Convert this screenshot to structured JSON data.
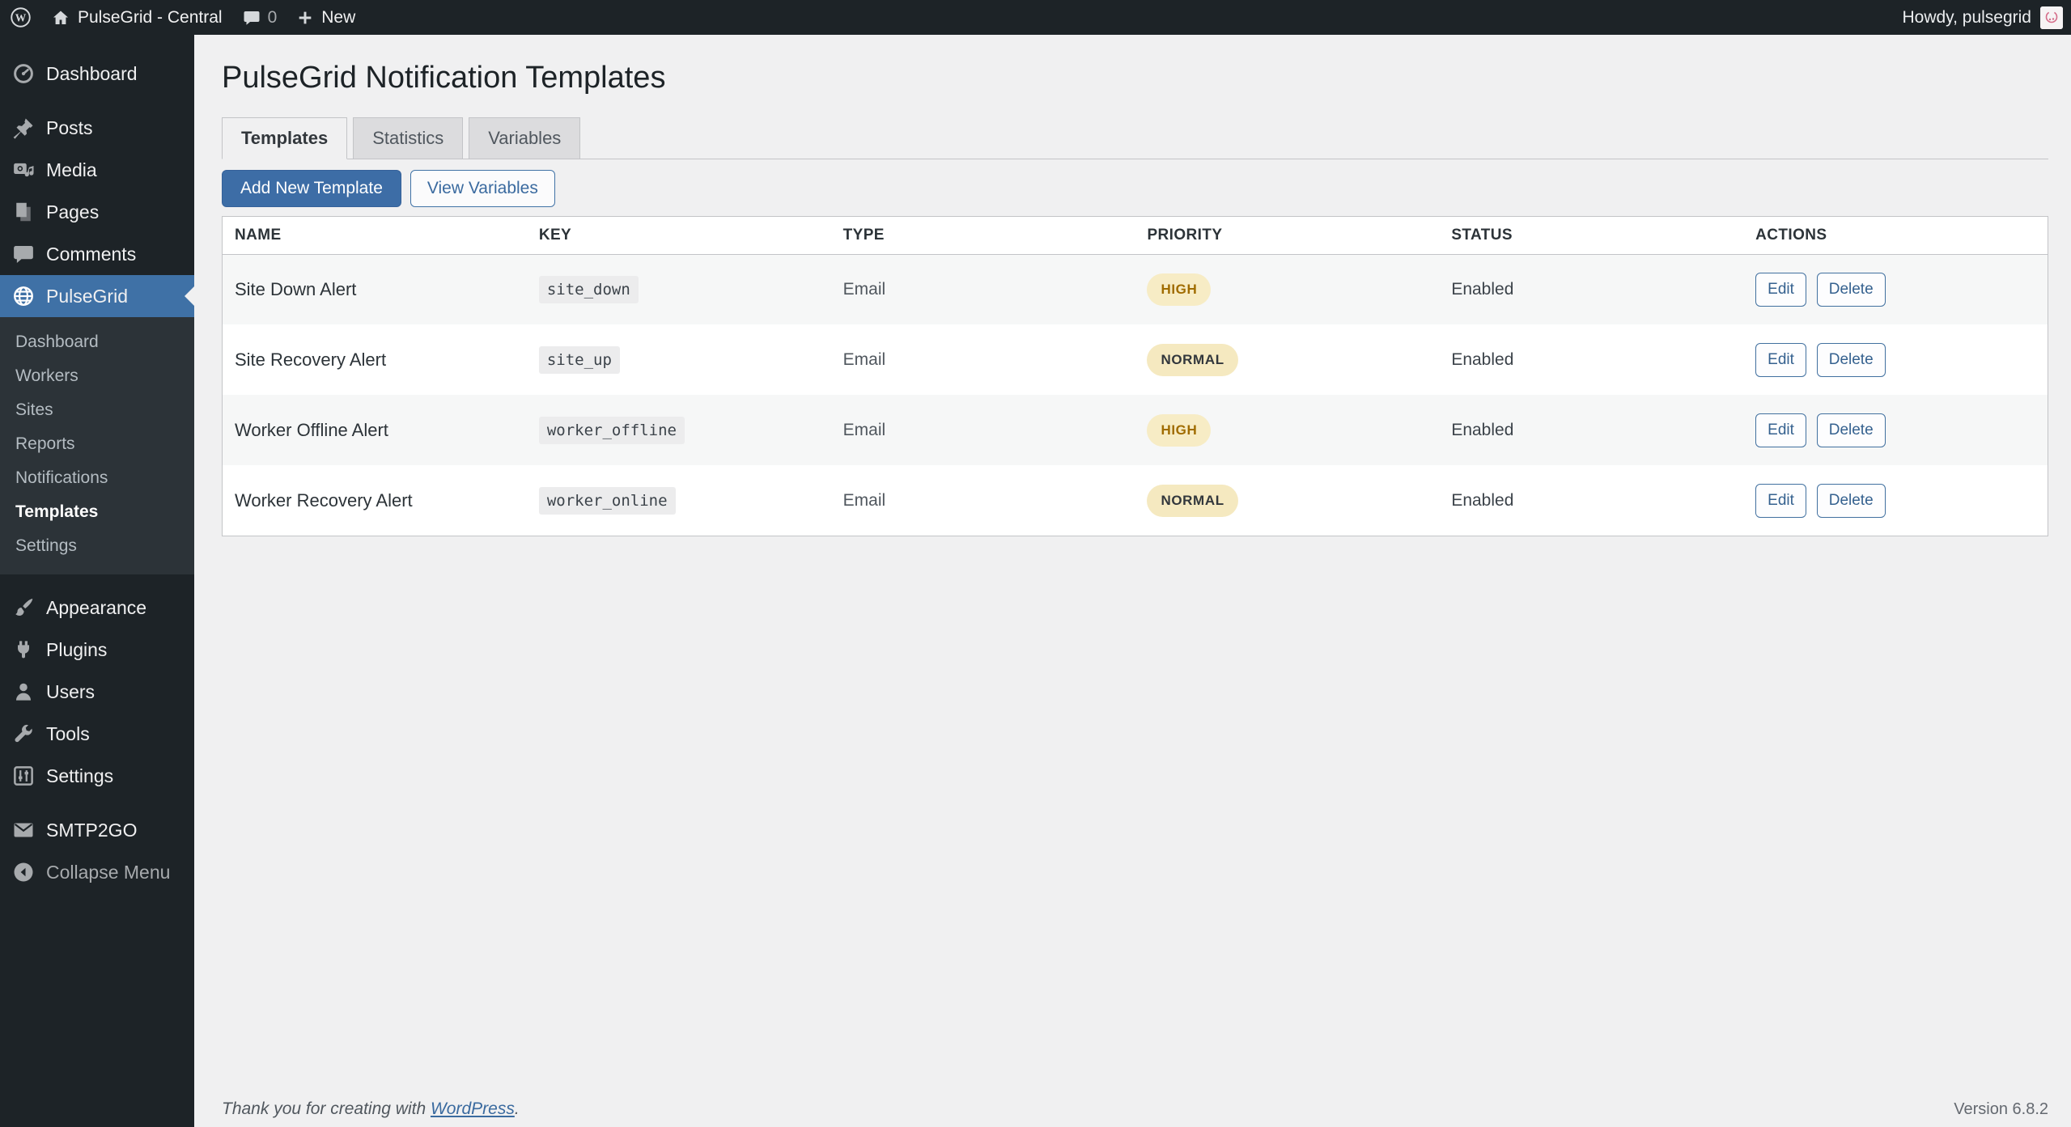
{
  "admin_bar": {
    "site_name": "PulseGrid - Central",
    "comments_count": "0",
    "new_label": "New",
    "howdy": "Howdy, pulsegrid"
  },
  "sidebar": {
    "items": [
      {
        "label": "Dashboard",
        "icon": "dashboard-icon"
      },
      {
        "label": "Posts",
        "icon": "pin-icon"
      },
      {
        "label": "Media",
        "icon": "media-icon"
      },
      {
        "label": "Pages",
        "icon": "pages-icon"
      },
      {
        "label": "Comments",
        "icon": "comment-icon"
      },
      {
        "label": "PulseGrid",
        "icon": "globe-icon",
        "active": true
      },
      {
        "label": "Appearance",
        "icon": "brush-icon"
      },
      {
        "label": "Plugins",
        "icon": "plug-icon"
      },
      {
        "label": "Users",
        "icon": "user-icon"
      },
      {
        "label": "Tools",
        "icon": "wrench-icon"
      },
      {
        "label": "Settings",
        "icon": "sliders-icon"
      },
      {
        "label": "SMTP2GO",
        "icon": "envelope-icon"
      },
      {
        "label": "Collapse Menu",
        "icon": "collapse-icon"
      }
    ],
    "submenu": {
      "items": [
        {
          "label": "Dashboard"
        },
        {
          "label": "Workers"
        },
        {
          "label": "Sites"
        },
        {
          "label": "Reports"
        },
        {
          "label": "Notifications"
        },
        {
          "label": "Templates",
          "current": true
        },
        {
          "label": "Settings"
        }
      ]
    }
  },
  "page": {
    "title": "PulseGrid Notification Templates",
    "tabs": [
      {
        "label": "Templates",
        "active": true
      },
      {
        "label": "Statistics",
        "active": false
      },
      {
        "label": "Variables",
        "active": false
      }
    ],
    "toolbar": {
      "add_new_label": "Add New Template",
      "view_variables_label": "View Variables"
    }
  },
  "table": {
    "headers": [
      "NAME",
      "KEY",
      "TYPE",
      "PRIORITY",
      "STATUS",
      "ACTIONS"
    ],
    "action_labels": {
      "edit": "Edit",
      "delete": "Delete"
    },
    "rows": [
      {
        "name": "Site Down Alert",
        "key": "site_down",
        "type": "Email",
        "priority": "HIGH",
        "status": "Enabled"
      },
      {
        "name": "Site Recovery Alert",
        "key": "site_up",
        "type": "Email",
        "priority": "NORMAL",
        "status": "Enabled"
      },
      {
        "name": "Worker Offline Alert",
        "key": "worker_offline",
        "type": "Email",
        "priority": "HIGH",
        "status": "Enabled"
      },
      {
        "name": "Worker Recovery Alert",
        "key": "worker_online",
        "type": "Email",
        "priority": "NORMAL",
        "status": "Enabled"
      }
    ]
  },
  "footer": {
    "thanks_prefix": "Thank you for creating with ",
    "wordpress_link": "WordPress",
    "thanks_suffix": ".",
    "version": "Version 6.8.2"
  },
  "colors": {
    "admin_bar_bg": "#1d2327",
    "sidebar_bg": "#1d2327",
    "submenu_bg": "#2c3338",
    "active_menu_bg": "#3f71a6",
    "primary_button_bg": "#3d6da6",
    "secondary_button_border": "#4173a6",
    "page_bg": "#f0f0f1",
    "card_border": "#c3c4c7",
    "stripe_row_bg": "#f6f7f7",
    "badge_bg": "#f6ebc3",
    "badge_high_text": "#a06c00",
    "badge_normal_text": "#32373c"
  }
}
